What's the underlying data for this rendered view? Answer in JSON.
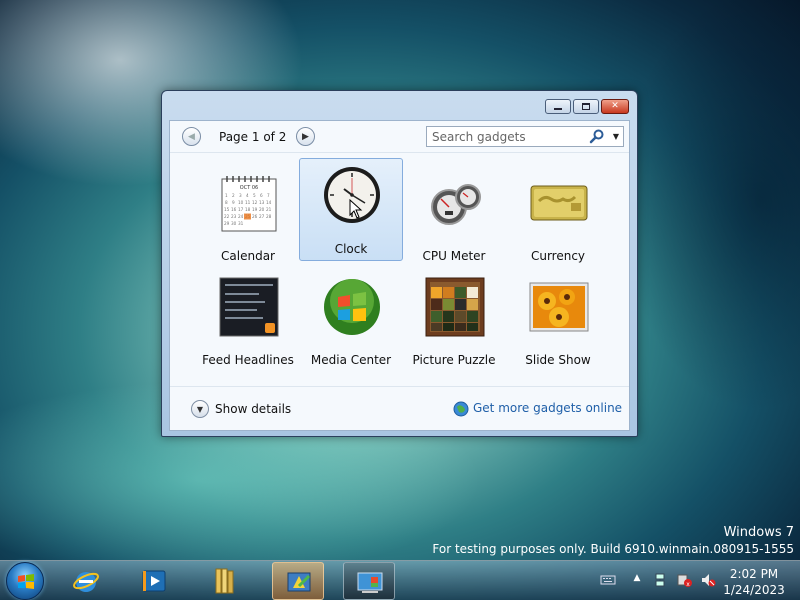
{
  "window": {
    "controls": [
      "minimize",
      "maximize",
      "close"
    ],
    "toolbar": {
      "page_label": "Page 1 of 2",
      "search_placeholder": "Search gadgets"
    },
    "gadgets": [
      {
        "label": "Calendar",
        "icon": "calendar-icon",
        "selected": false
      },
      {
        "label": "Clock",
        "icon": "clock-icon",
        "selected": true
      },
      {
        "label": "CPU Meter",
        "icon": "cpu-meter-icon",
        "selected": false
      },
      {
        "label": "Currency",
        "icon": "currency-icon",
        "selected": false
      },
      {
        "label": "Feed Headlines",
        "icon": "feed-headlines-icon",
        "selected": false
      },
      {
        "label": "Media Center",
        "icon": "media-center-icon",
        "selected": false
      },
      {
        "label": "Picture Puzzle",
        "icon": "picture-puzzle-icon",
        "selected": false
      },
      {
        "label": "Slide Show",
        "icon": "slide-show-icon",
        "selected": false
      }
    ],
    "calendar_month": "OCT 06",
    "footer": {
      "show_details": "Show details",
      "more_gadgets": "Get more gadgets online"
    }
  },
  "watermark": {
    "line1": "Windows 7",
    "line2": "For testing purposes only. Build 6910.winmain.080915-1555"
  },
  "taskbar": {
    "time": "2:02 PM",
    "date": "1/24/2023"
  }
}
